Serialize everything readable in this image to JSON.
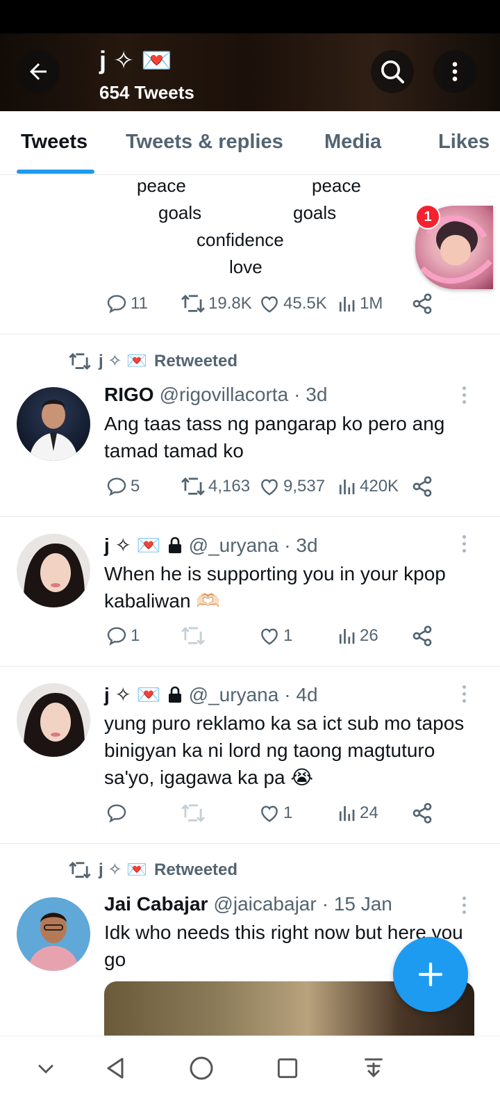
{
  "header": {
    "display_name": "j ✧ 💌",
    "tweet_count": "654 Tweets"
  },
  "tabs": [
    {
      "label": "Tweets",
      "active": true
    },
    {
      "label": "Tweets & replies",
      "active": false
    },
    {
      "label": "Media",
      "active": false
    },
    {
      "label": "Likes",
      "active": false
    }
  ],
  "chat_bubble": {
    "badge": "1"
  },
  "tweet0": {
    "poem": {
      "l1a": "peace",
      "l1b": "peace",
      "l2a": "goals",
      "l2b": "goals",
      "l3": "confidence",
      "l4": "love"
    },
    "replies": "11",
    "retweets": "19.8K",
    "likes": "45.5K",
    "views": "1M"
  },
  "tweet1": {
    "retweeted_by": "j ✧ 💌",
    "retweeted_label": "Retweeted",
    "name": "RIGO",
    "handle": "@rigovillacorta",
    "time": "· 3d",
    "text": "Ang taas tass ng pangarap ko pero ang tamad tamad ko",
    "replies": "5",
    "retweets": "4,163",
    "likes": "9,537",
    "views": "420K"
  },
  "tweet2": {
    "name": "j ✧ 💌",
    "handle": "@_uryana",
    "time": "· 3d",
    "text": "When he is supporting you in your kpop kabaliwan 🫶🏻",
    "replies": "1",
    "retweets": "",
    "likes": "1",
    "views": "26"
  },
  "tweet3": {
    "name": "j ✧ 💌",
    "handle": "@_uryana",
    "time": "· 4d",
    "text": "yung puro reklamo ka sa ict sub mo tapos binigyan ka ni lord ng taong magtuturo sa'yo, igagawa ka pa 😭",
    "replies": "",
    "retweets": "",
    "likes": "1",
    "views": "24"
  },
  "tweet4": {
    "retweeted_by": "j ✧ 💌",
    "retweeted_label": "Retweeted",
    "name": "Jai Cabajar",
    "handle": "@jaicabajar",
    "time": "· 15 Jan",
    "text": "Idk who needs this right now but here you go"
  },
  "colors": {
    "accent": "#1d9bf0",
    "secondary_text": "#536471",
    "badge": "#f4212e"
  }
}
